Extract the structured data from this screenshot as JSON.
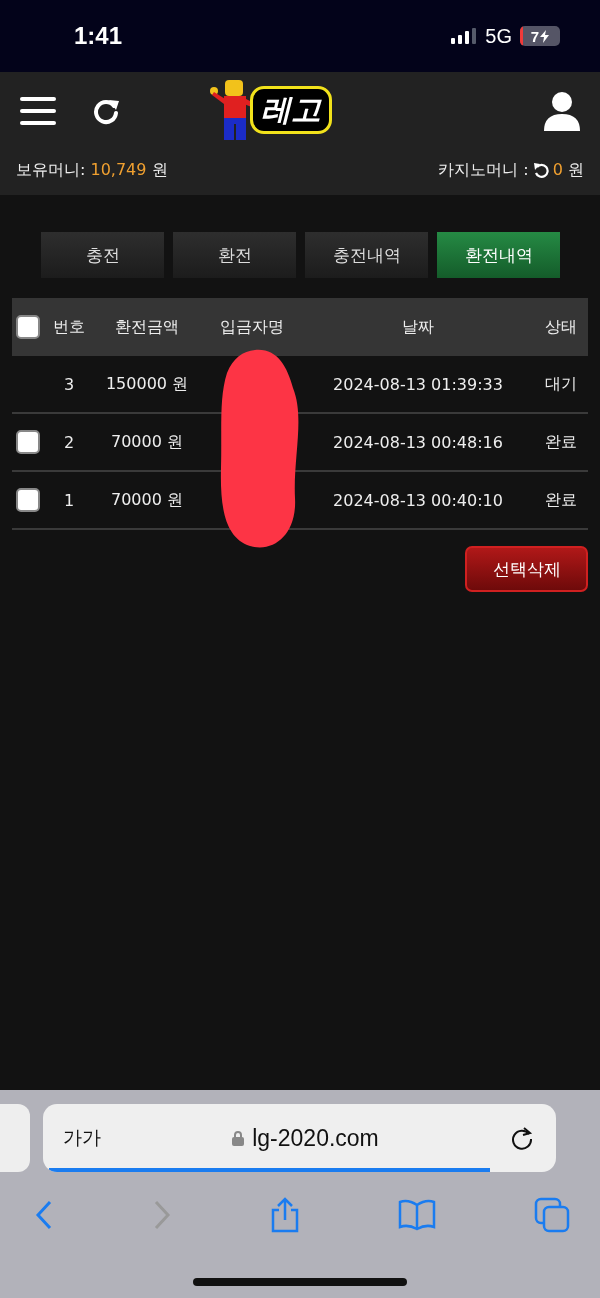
{
  "status_bar": {
    "time": "1:41",
    "network": "5G",
    "battery": "7"
  },
  "header": {
    "logo": "레고",
    "balance_label": "보유머니:",
    "balance": "10,749",
    "balance_unit": "원",
    "casino_label": "카지노머니 :",
    "casino": "0",
    "casino_unit": "원"
  },
  "tabs": [
    {
      "label": "충전",
      "selected": false
    },
    {
      "label": "환전",
      "selected": false
    },
    {
      "label": "충전내역",
      "selected": false
    },
    {
      "label": "환전내역",
      "selected": true
    }
  ],
  "table": {
    "header_checkbox": {
      "checked": false
    },
    "columns": [
      "번호",
      "환전금액",
      "입금자명",
      "날짜",
      "상태"
    ],
    "rows": [
      {
        "number": "3",
        "amount": "150000 원",
        "date": "2024-08-13 01:39:33",
        "status": "대기"
      },
      {
        "checked": false,
        "number": "2",
        "amount": "70000 원",
        "date": "2024-08-13 00:48:16",
        "status": "완료"
      },
      {
        "checked": false,
        "number": "1",
        "amount": "70000 원",
        "date": "2024-08-13 00:40:10",
        "status": "완료"
      }
    ]
  },
  "delete_button": "선택삭제",
  "browser": {
    "text_size": "가가",
    "url": "lg-2020.com",
    "progress": {
      "level": 0.88
    },
    "back_enabled": true,
    "forward_enabled": false
  }
}
